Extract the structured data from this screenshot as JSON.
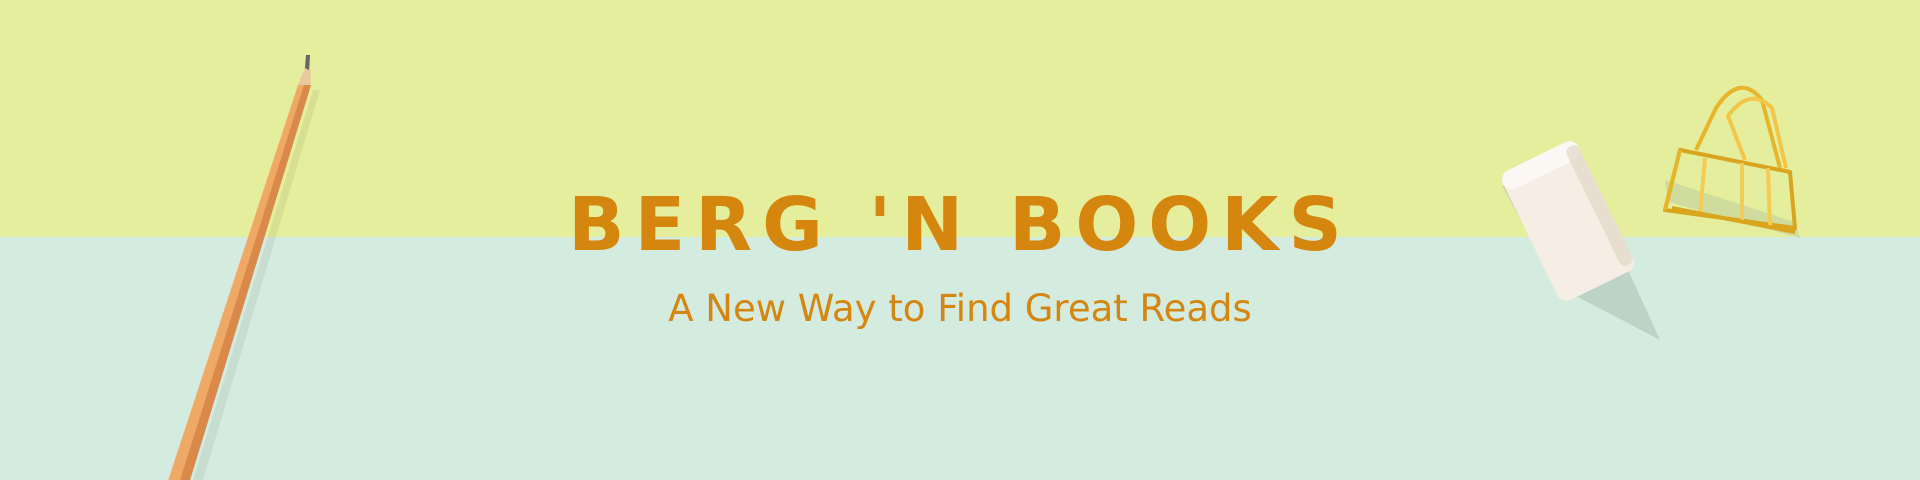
{
  "banner": {
    "title": "BERG 'N BOOKS",
    "tagline": "A New Way to Find Great Reads"
  },
  "colors": {
    "top_background": "#e4ee9c",
    "bottom_background": "#d4ebe0",
    "text_accent": "#d4860f",
    "pencil": "#f0a865",
    "eraser": "#f6eee4",
    "clip": "#e8b52a"
  },
  "decorations": [
    "pencil-icon",
    "eraser-icon",
    "binder-clip-icon"
  ]
}
